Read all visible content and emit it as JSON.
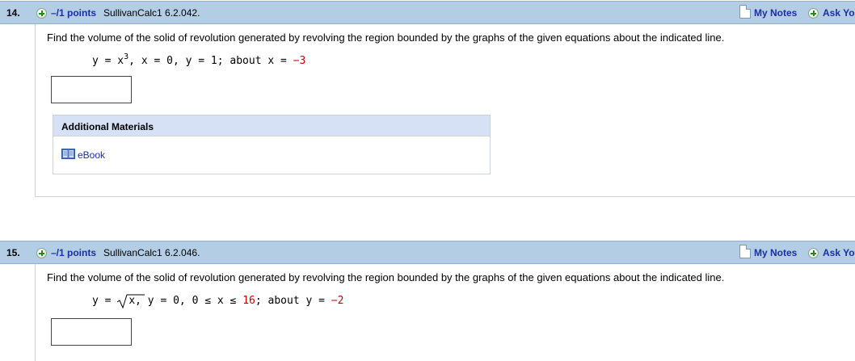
{
  "questions": [
    {
      "number": "14.",
      "points": "–/1 points",
      "source": "SullivanCalc1 6.2.042.",
      "my_notes": "My Notes",
      "ask_your_teacher": "Ask Yo",
      "prompt": "Find the volume of the solid of revolution generated by revolving the region bounded by the graphs of the given equations about the indicated line.",
      "equation": {
        "part1": "y = x",
        "exp": "3",
        "part2": ",  x = 0,  y = 1;  about  x = ",
        "axis_value": "−3"
      },
      "answer_value": ""
    },
    {
      "number": "15.",
      "points": "–/1 points",
      "source": "SullivanCalc1 6.2.046.",
      "my_notes": "My Notes",
      "ask_your_teacher": "Ask Yo",
      "prompt": "Find the volume of the solid of revolution generated by revolving the region bounded by the graphs of the given equations about the indicated line.",
      "equation": {
        "part1": "y = ",
        "radicand": "x",
        "part2": ",  y = 0,  0 ≤ x ≤ ",
        "bound": "16",
        "part3": ";  about  y = ",
        "axis_value": "−2"
      },
      "answer_value": ""
    }
  ],
  "additional_materials": {
    "title": "Additional Materials",
    "ebook_label": "eBook"
  },
  "icons": {
    "expand": "plus-circle-icon",
    "notes": "note-page-icon",
    "ebook": "book-icon"
  },
  "colors": {
    "header_bg": "#b3cde4",
    "link": "#1a2fa8",
    "highlight_value": "#d00000",
    "materials_header_bg": "#d6e1f6"
  }
}
